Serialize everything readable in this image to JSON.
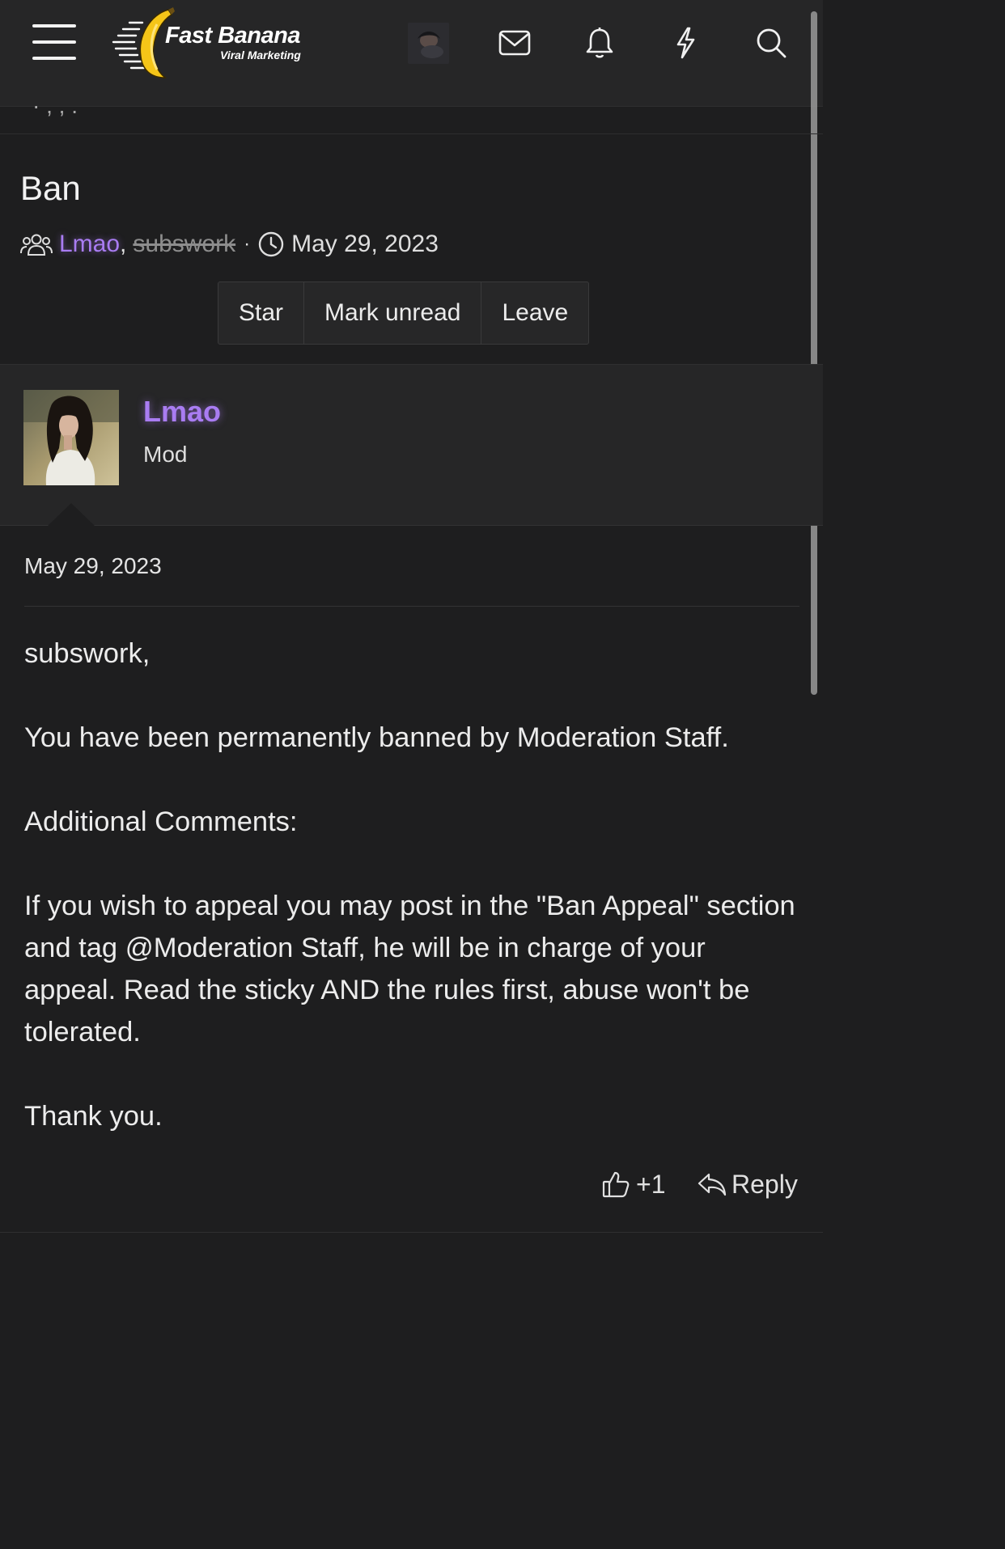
{
  "header": {
    "logo": {
      "title": "Fast Banana",
      "subtitle": "Viral Marketing"
    },
    "icons": [
      "menu-icon",
      "envelope-icon",
      "bell-icon",
      "lightning-icon",
      "search-icon"
    ]
  },
  "breadcrumb": {
    "fragment": "· , ,  ."
  },
  "conversation": {
    "title": "Ban",
    "participants": [
      {
        "name": "Lmao"
      },
      {
        "name": "subswork",
        "removed": true
      }
    ],
    "separator": ",",
    "dot": "·",
    "date": "May 29, 2023",
    "buttons": {
      "star": "Star",
      "mark_unread": "Mark unread",
      "leave": "Leave"
    }
  },
  "message": {
    "author": "Lmao",
    "role": "Mod",
    "date": "May 29, 2023",
    "paragraphs": [
      "subswork,",
      "You have been permanently banned by Moderation Staff.",
      "Additional Comments:",
      "If you wish to appeal you may post in the \"Ban Appeal\" section and tag @Moderation Staff, he will be in charge of your appeal. Read the sticky AND the rules first, abuse won't be tolerated.",
      "Thank you."
    ],
    "actions": {
      "like_count": "+1",
      "reply": "Reply"
    }
  },
  "colors": {
    "background": "#1e1e1f",
    "header": "#262627",
    "username": "#a97cf2",
    "text": "#ececec"
  }
}
